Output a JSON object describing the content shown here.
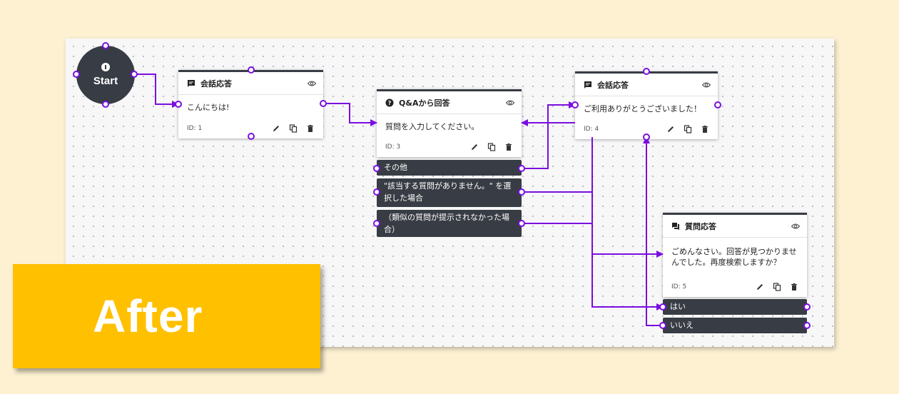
{
  "start": {
    "label": "Start"
  },
  "nodes": {
    "greet": {
      "title": "会話応答",
      "text": "こんにちは!",
      "id": "ID: 1"
    },
    "qa": {
      "title": "Q&Aから回答",
      "text": "質問を入力してください。",
      "id": "ID: 3"
    },
    "thanks": {
      "title": "会話応答",
      "text": "ご利用ありがとうございました！",
      "id": "ID: 4"
    },
    "question": {
      "title": "質問応答",
      "text": "ごめんなさい。回答が見つかりませんでした。再度検索しますか？",
      "id": "ID: 5"
    }
  },
  "qa_options": [
    "その他",
    "\"該当する質問がありません。\" を選択した場合",
    "（類似の質問が提示されなかった場合）"
  ],
  "question_options": [
    "はい",
    "いいえ"
  ],
  "badge": {
    "label": "After"
  },
  "colors": {
    "accent": "#7a0ee0",
    "node_dark": "#383c44",
    "badge": "#ffc000",
    "background": "#fdf1d2"
  }
}
